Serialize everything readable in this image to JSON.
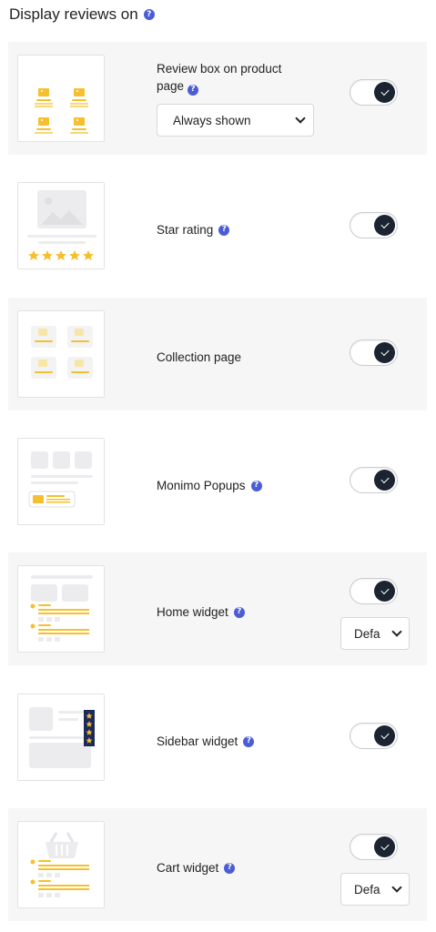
{
  "section": {
    "title": "Display reviews on",
    "help_glyph": "?"
  },
  "rows": [
    {
      "label": "Review box on product page",
      "has_help": true,
      "enabled": true,
      "select": "Always shown",
      "thumb_icon": "review-box-thumbnail"
    },
    {
      "label": "Star rating",
      "has_help": true,
      "enabled": true,
      "thumb_icon": "star-rating-thumbnail"
    },
    {
      "label": "Collection page",
      "has_help": false,
      "enabled": true,
      "thumb_icon": "collection-page-thumbnail"
    },
    {
      "label": "Monimo Popups",
      "has_help": true,
      "enabled": true,
      "thumb_icon": "popups-thumbnail"
    },
    {
      "label": "Home widget",
      "has_help": true,
      "enabled": true,
      "select": "Defa",
      "thumb_icon": "home-widget-thumbnail"
    },
    {
      "label": "Sidebar widget",
      "has_help": true,
      "enabled": true,
      "thumb_icon": "sidebar-widget-thumbnail"
    },
    {
      "label": "Cart widget",
      "has_help": true,
      "enabled": true,
      "select": "Defa",
      "thumb_icon": "cart-widget-thumbnail"
    }
  ],
  "colors": {
    "accent_star": "#f5c02f",
    "help_icon": "#4a5cd6",
    "toggle_knob": "#1c2431",
    "row_shade": "#f6f6f7"
  }
}
